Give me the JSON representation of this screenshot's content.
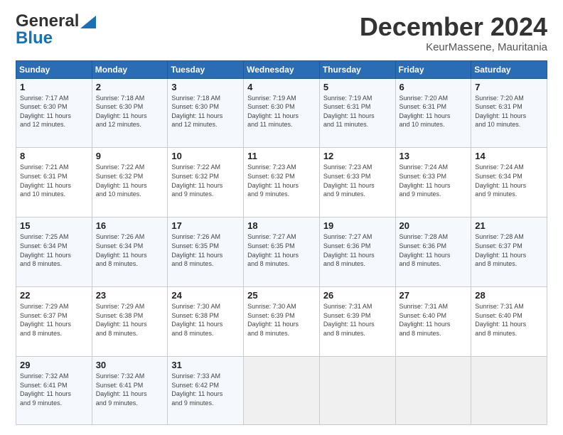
{
  "header": {
    "logo_line1": "General",
    "logo_line2": "Blue",
    "month_title": "December 2024",
    "location": "KeurMassene, Mauritania"
  },
  "days_of_week": [
    "Sunday",
    "Monday",
    "Tuesday",
    "Wednesday",
    "Thursday",
    "Friday",
    "Saturday"
  ],
  "weeks": [
    [
      {
        "day": 1,
        "info": "Sunrise: 7:17 AM\nSunset: 6:30 PM\nDaylight: 11 hours\nand 12 minutes."
      },
      {
        "day": 2,
        "info": "Sunrise: 7:18 AM\nSunset: 6:30 PM\nDaylight: 11 hours\nand 12 minutes."
      },
      {
        "day": 3,
        "info": "Sunrise: 7:18 AM\nSunset: 6:30 PM\nDaylight: 11 hours\nand 12 minutes."
      },
      {
        "day": 4,
        "info": "Sunrise: 7:19 AM\nSunset: 6:30 PM\nDaylight: 11 hours\nand 11 minutes."
      },
      {
        "day": 5,
        "info": "Sunrise: 7:19 AM\nSunset: 6:31 PM\nDaylight: 11 hours\nand 11 minutes."
      },
      {
        "day": 6,
        "info": "Sunrise: 7:20 AM\nSunset: 6:31 PM\nDaylight: 11 hours\nand 10 minutes."
      },
      {
        "day": 7,
        "info": "Sunrise: 7:20 AM\nSunset: 6:31 PM\nDaylight: 11 hours\nand 10 minutes."
      }
    ],
    [
      {
        "day": 8,
        "info": "Sunrise: 7:21 AM\nSunset: 6:31 PM\nDaylight: 11 hours\nand 10 minutes."
      },
      {
        "day": 9,
        "info": "Sunrise: 7:22 AM\nSunset: 6:32 PM\nDaylight: 11 hours\nand 10 minutes."
      },
      {
        "day": 10,
        "info": "Sunrise: 7:22 AM\nSunset: 6:32 PM\nDaylight: 11 hours\nand 9 minutes."
      },
      {
        "day": 11,
        "info": "Sunrise: 7:23 AM\nSunset: 6:32 PM\nDaylight: 11 hours\nand 9 minutes."
      },
      {
        "day": 12,
        "info": "Sunrise: 7:23 AM\nSunset: 6:33 PM\nDaylight: 11 hours\nand 9 minutes."
      },
      {
        "day": 13,
        "info": "Sunrise: 7:24 AM\nSunset: 6:33 PM\nDaylight: 11 hours\nand 9 minutes."
      },
      {
        "day": 14,
        "info": "Sunrise: 7:24 AM\nSunset: 6:34 PM\nDaylight: 11 hours\nand 9 minutes."
      }
    ],
    [
      {
        "day": 15,
        "info": "Sunrise: 7:25 AM\nSunset: 6:34 PM\nDaylight: 11 hours\nand 8 minutes."
      },
      {
        "day": 16,
        "info": "Sunrise: 7:26 AM\nSunset: 6:34 PM\nDaylight: 11 hours\nand 8 minutes."
      },
      {
        "day": 17,
        "info": "Sunrise: 7:26 AM\nSunset: 6:35 PM\nDaylight: 11 hours\nand 8 minutes."
      },
      {
        "day": 18,
        "info": "Sunrise: 7:27 AM\nSunset: 6:35 PM\nDaylight: 11 hours\nand 8 minutes."
      },
      {
        "day": 19,
        "info": "Sunrise: 7:27 AM\nSunset: 6:36 PM\nDaylight: 11 hours\nand 8 minutes."
      },
      {
        "day": 20,
        "info": "Sunrise: 7:28 AM\nSunset: 6:36 PM\nDaylight: 11 hours\nand 8 minutes."
      },
      {
        "day": 21,
        "info": "Sunrise: 7:28 AM\nSunset: 6:37 PM\nDaylight: 11 hours\nand 8 minutes."
      }
    ],
    [
      {
        "day": 22,
        "info": "Sunrise: 7:29 AM\nSunset: 6:37 PM\nDaylight: 11 hours\nand 8 minutes."
      },
      {
        "day": 23,
        "info": "Sunrise: 7:29 AM\nSunset: 6:38 PM\nDaylight: 11 hours\nand 8 minutes."
      },
      {
        "day": 24,
        "info": "Sunrise: 7:30 AM\nSunset: 6:38 PM\nDaylight: 11 hours\nand 8 minutes."
      },
      {
        "day": 25,
        "info": "Sunrise: 7:30 AM\nSunset: 6:39 PM\nDaylight: 11 hours\nand 8 minutes."
      },
      {
        "day": 26,
        "info": "Sunrise: 7:31 AM\nSunset: 6:39 PM\nDaylight: 11 hours\nand 8 minutes."
      },
      {
        "day": 27,
        "info": "Sunrise: 7:31 AM\nSunset: 6:40 PM\nDaylight: 11 hours\nand 8 minutes."
      },
      {
        "day": 28,
        "info": "Sunrise: 7:31 AM\nSunset: 6:40 PM\nDaylight: 11 hours\nand 8 minutes."
      }
    ],
    [
      {
        "day": 29,
        "info": "Sunrise: 7:32 AM\nSunset: 6:41 PM\nDaylight: 11 hours\nand 9 minutes."
      },
      {
        "day": 30,
        "info": "Sunrise: 7:32 AM\nSunset: 6:41 PM\nDaylight: 11 hours\nand 9 minutes."
      },
      {
        "day": 31,
        "info": "Sunrise: 7:33 AM\nSunset: 6:42 PM\nDaylight: 11 hours\nand 9 minutes."
      },
      null,
      null,
      null,
      null
    ]
  ]
}
